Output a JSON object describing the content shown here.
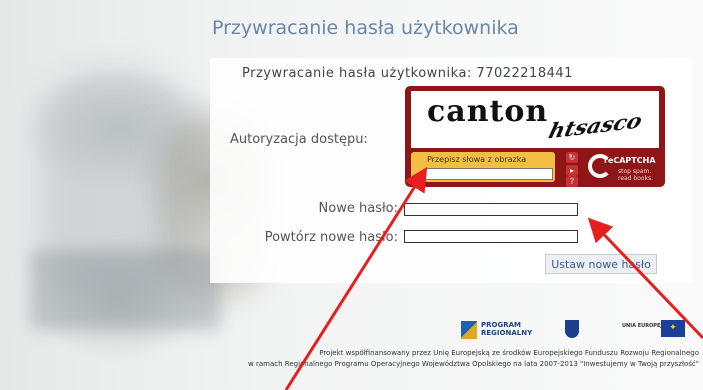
{
  "page": {
    "title": "Przywracanie hasła użytkownika",
    "subtitle": "Przywracanie hasła użytkownika: 77022218441"
  },
  "form": {
    "auth_label": "Autoryzacja dostępu:",
    "new_password_label": "Nowe hasło:",
    "repeat_password_label": "Powtórz nowe hasło:",
    "new_password_value": "",
    "repeat_password_value": "",
    "submit_label": "Ustaw nowe hasło"
  },
  "captcha": {
    "word1": "canton",
    "word2": "htsasco",
    "prompt": "Przepisz słowa z obrazka",
    "input_value": "",
    "controls": [
      "refresh-icon",
      "audio-icon",
      "help-icon"
    ],
    "brand": "reCAPTCHA",
    "tagline": "stop spam. read books."
  },
  "logos": {
    "program": "PROGRAM REGIONALNY",
    "eu": "UNIA EUROPEJSKA"
  },
  "footer": {
    "line1": "Projekt współfinansowany przez Unię Europejską ze środków Europejskiego Funduszu Rozwoju Regionalnego",
    "line2": "w ramach Regionalnego Programu Operacyjnego Województwa Opolskiego na lata 2007-2013 \"Inwestujemy w Twoją przyszłość\""
  },
  "colors": {
    "title_blue": "#6a86a8",
    "captcha_red": "#8e1616",
    "captcha_yellow": "#f4bd44",
    "annotation_arrow": "#e61e1e"
  }
}
